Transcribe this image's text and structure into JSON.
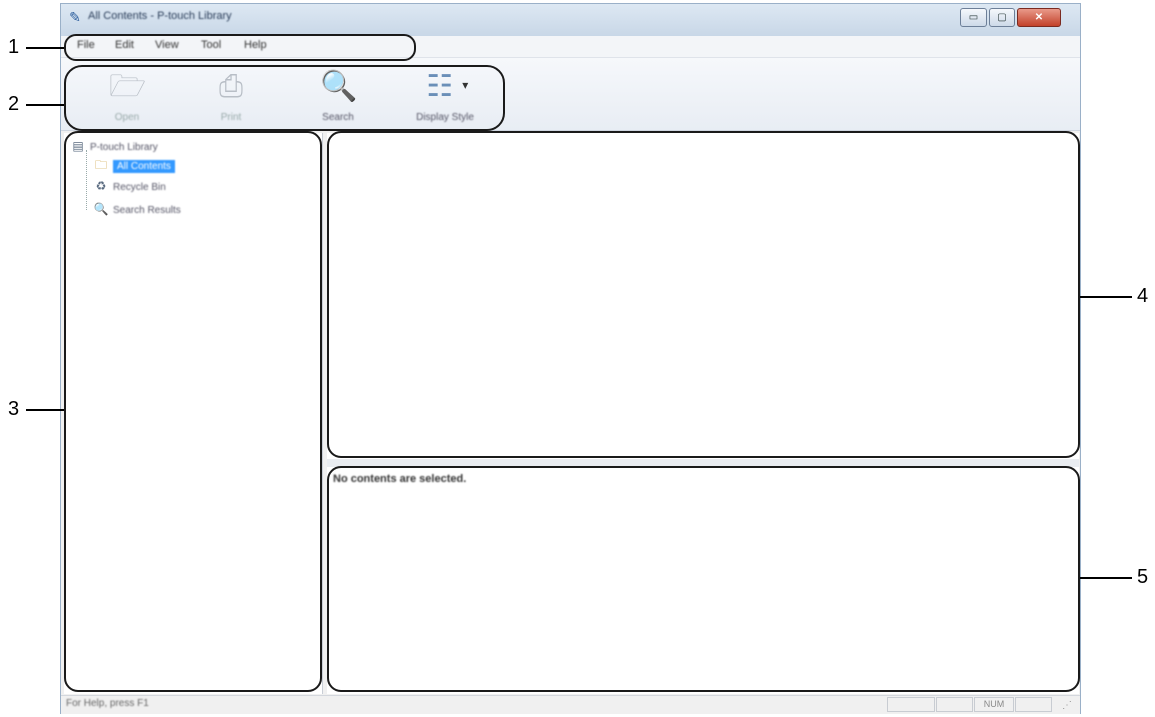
{
  "window": {
    "title": "All Contents - P-touch Library",
    "icon": "p-touch-app-icon",
    "controls": {
      "minimize": "▭",
      "maximize": "▢",
      "close": "✕"
    }
  },
  "menubar": {
    "items": [
      {
        "label": "File"
      },
      {
        "label": "Edit"
      },
      {
        "label": "View"
      },
      {
        "label": "Tool"
      },
      {
        "label": "Help"
      }
    ]
  },
  "toolbar": {
    "buttons": [
      {
        "label": "Open",
        "icon": "open-folder-icon",
        "glyph": "🗁",
        "enabled": false
      },
      {
        "label": "Print",
        "icon": "print-icon",
        "glyph": "⎙",
        "enabled": false
      },
      {
        "label": "Search",
        "icon": "search-icon",
        "glyph": "🔍",
        "enabled": true
      },
      {
        "label": "Display Style",
        "icon": "display-style-icon",
        "glyph": "☷",
        "enabled": true,
        "dropdown": "▾"
      }
    ]
  },
  "tree": {
    "root": {
      "label": "P-touch Library",
      "icon": "library-icon",
      "glyph": "▤"
    },
    "items": [
      {
        "label": "All Contents",
        "icon": "folder-icon",
        "glyph": "🗀",
        "selected": true
      },
      {
        "label": "Recycle Bin",
        "icon": "recycle-bin-icon",
        "glyph": "♻",
        "selected": false
      },
      {
        "label": "Search Results",
        "icon": "search-results-icon",
        "glyph": "🔍",
        "selected": false
      }
    ]
  },
  "preview": {
    "message": "No contents are selected."
  },
  "statusbar": {
    "text": "For Help, press F1",
    "indicators": [
      "",
      "",
      "NUM",
      ""
    ]
  },
  "callouts": [
    "1",
    "2",
    "3",
    "4",
    "5"
  ],
  "colors": {
    "outline": "#1a1a1a",
    "selection": "#3399ff",
    "close_button": "#c2412a"
  }
}
